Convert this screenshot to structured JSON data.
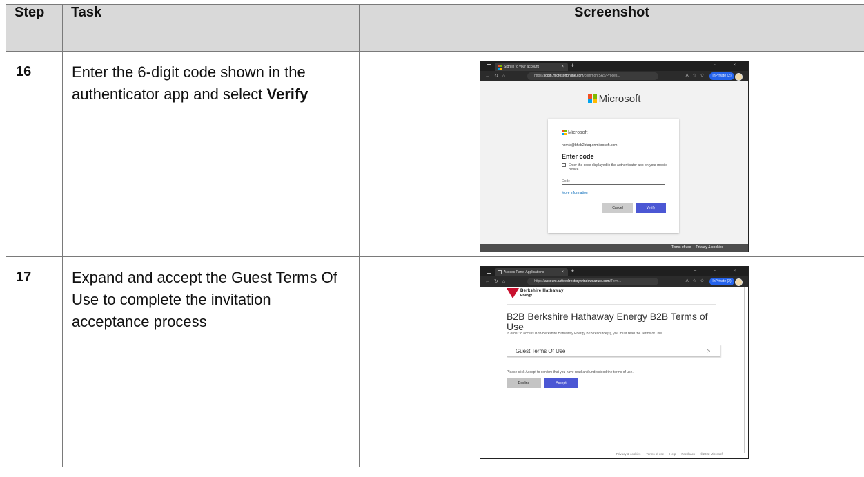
{
  "table": {
    "headers": {
      "step": "Step",
      "task": "Task",
      "screenshot": "Screenshot"
    },
    "rows": [
      {
        "step": "16",
        "task_text": "Enter the 6-digit code shown in the authenticator app and select ",
        "task_bold": "Verify"
      },
      {
        "step": "17",
        "task_text": "Expand and accept the Guest Terms Of Use to complete the invitation acceptance process",
        "task_bold": ""
      }
    ]
  },
  "screenshot1": {
    "tab_title": "Sign in to your account",
    "window_controls": "– ▫ ×",
    "url_prefix": "https://",
    "url_domain": "login.microsoftonline.com",
    "url_path": "/common/SAS/Proces...",
    "inprivate_label": "InPrivate (2)",
    "brand": "Microsoft",
    "account": "nomfa@bhxb2bfaq.onmicrosoft.com",
    "heading": "Enter code",
    "hint": "Enter the code displayed in the authenticator app on your mobile device",
    "code_placeholder": "Code",
    "more_info": "More information",
    "cancel": "Cancel",
    "verify": "Verify",
    "footer_terms": "Terms of use",
    "footer_privacy": "Privacy & cookies",
    "footer_more": "···"
  },
  "screenshot2": {
    "tab_title": "Access Panel Applications",
    "window_controls": "– ▫ ×",
    "url_prefix": "https://",
    "url_domain": "account.activedirectory.windowsazure.com",
    "url_path": "/Term...",
    "inprivate_label": "InPrivate (2)",
    "logo_line1": "Berkshire Hathaway",
    "logo_line2": "Energy",
    "title": "B2B Berkshire Hathaway Energy B2B Terms of Use",
    "subtitle": "In order to access B2B Berkshire Hathaway Energy B2B resource(s), you must read the Terms of Use.",
    "expander_label": "Guest Terms Of Use",
    "confirm_text": "Please click Accept to confirm that you have read and understood the terms of use.",
    "decline": "Decline",
    "accept": "Accept",
    "footer": [
      "Privacy & cookies",
      "Terms of use",
      "Help",
      "Feedback",
      "©2022 Microsoft"
    ]
  }
}
